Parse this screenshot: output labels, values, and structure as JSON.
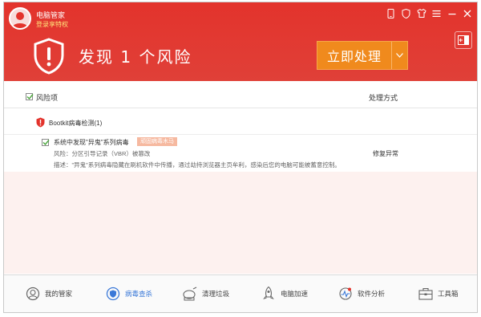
{
  "header": {
    "user_name": "电脑管家",
    "user_status": "登录享特权",
    "headline": "发现 1 个风险",
    "action_label": "立即处理"
  },
  "table": {
    "col_risk": "风险项",
    "col_handle": "处理方式"
  },
  "group": {
    "label": "Bootkit病毒检测(1)"
  },
  "item": {
    "title": "系统中发现\"异鬼\"系列病毒",
    "tag": "顽固病毒木马",
    "risk": "风险：分区引导记录（VBR）被篡改",
    "description": "描述：\"异鬼\"系列病毒隐藏在刷机软件中传播，通过劫持浏览器主页牟利，感染后您的电脑可能被蓄意控制。",
    "action": "修复异常"
  },
  "bottom_nav": [
    {
      "label": "我的管家",
      "icon": "home-icon"
    },
    {
      "label": "病毒查杀",
      "icon": "virus-scan-icon",
      "active": true
    },
    {
      "label": "清理垃圾",
      "icon": "cleanup-icon"
    },
    {
      "label": "电脑加速",
      "icon": "rocket-icon"
    },
    {
      "label": "软件分析",
      "icon": "software-analysis-icon"
    },
    {
      "label": "工具箱",
      "icon": "toolbox-icon"
    }
  ],
  "colors": {
    "header_red": "#e3332c",
    "action_orange": "#f08a1d",
    "active_blue": "#3b79d8",
    "check_green": "#4aa63c"
  }
}
